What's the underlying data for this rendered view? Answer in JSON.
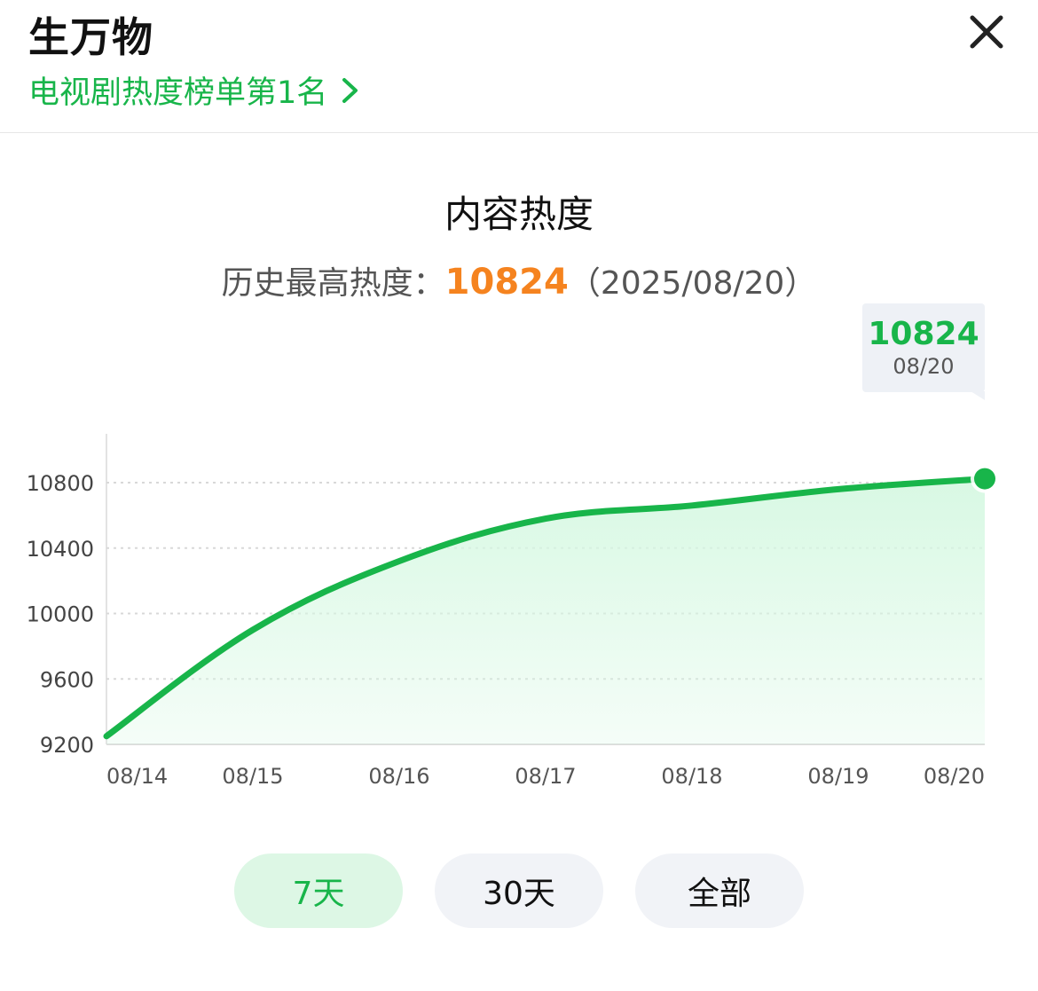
{
  "header": {
    "title": "生万物",
    "rank_text": "电视剧热度榜单第1名"
  },
  "section": {
    "title": "内容热度",
    "record_label": "历史最高热度：",
    "record_value": "10824",
    "record_date": "（2025/08/20）"
  },
  "tooltip": {
    "value": "10824",
    "date": "08/20"
  },
  "colors": {
    "accent": "#18b54a",
    "highlight": "#f5831f",
    "area_fill": "#d6f8e2"
  },
  "chart_data": {
    "type": "area",
    "title": "",
    "xlabel": "",
    "ylabel": "",
    "categories": [
      "08/14",
      "08/15",
      "08/16",
      "08/17",
      "08/18",
      "08/19",
      "08/20"
    ],
    "series": [
      {
        "values": [
          9250,
          9900,
          10320,
          10580,
          10660,
          10760,
          10824
        ]
      }
    ],
    "yticks": [
      9200,
      9600,
      10000,
      10400,
      10800
    ],
    "ylim": [
      9200,
      10800
    ],
    "grid": "horizontal dotted",
    "highlight_point": {
      "x": "08/20",
      "y": 10824
    }
  },
  "range_tabs": [
    {
      "label": "7天",
      "active": true
    },
    {
      "label": "30天",
      "active": false
    },
    {
      "label": "全部",
      "active": false
    }
  ]
}
